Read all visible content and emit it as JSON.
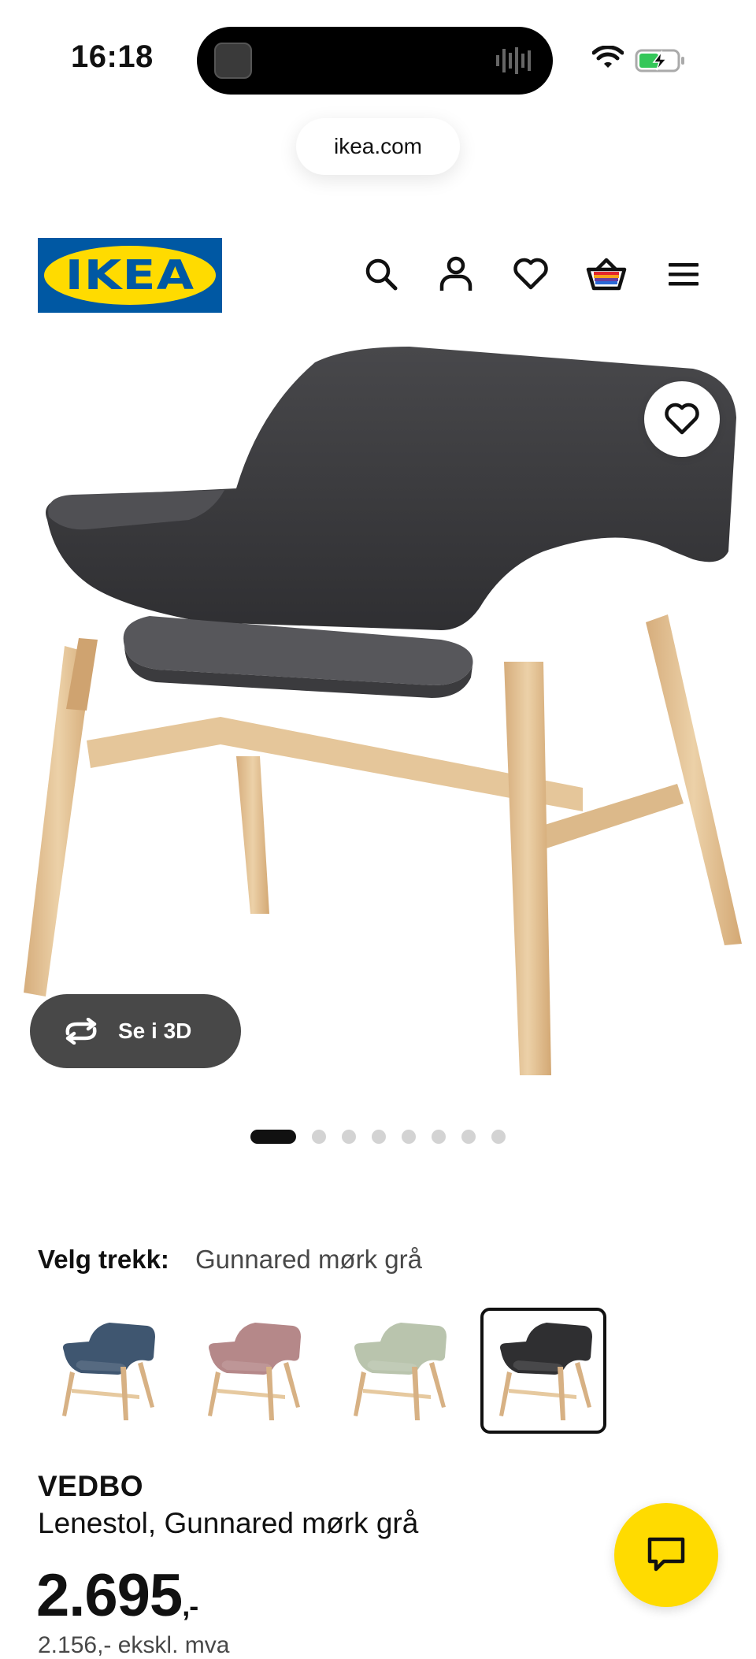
{
  "status_bar": {
    "time": "16:18",
    "island_icon": "audio-waveform-icon",
    "wifi_icon": "wifi-icon",
    "battery_icon": "battery-charging-icon"
  },
  "browser": {
    "url": "ikea.com"
  },
  "header": {
    "logo_text": "IKEA",
    "logo_reg": "®",
    "icons": [
      "search-icon",
      "account-icon",
      "heart-icon",
      "basket-icon",
      "menu-icon"
    ]
  },
  "gallery": {
    "view_3d_label": "Se i 3D",
    "total_images": 8,
    "active_index": 0
  },
  "variants": {
    "label": "Velg trekk:",
    "selected_value": "Gunnared mørk grå",
    "options": [
      {
        "color": "#3f5670",
        "selected": false
      },
      {
        "color": "#b58889",
        "selected": false
      },
      {
        "color": "#b9c4ad",
        "selected": false
      },
      {
        "color": "#2f2f31",
        "selected": true
      }
    ]
  },
  "product": {
    "name": "VEDBO",
    "description": "Lenestol, Gunnared mørk grå",
    "price": "2.695",
    "price_suffix": ",-",
    "vat_line": "2.156,- ekskl. mva"
  },
  "colors": {
    "ikea_blue": "#0058a3",
    "ikea_yellow": "#ffdb00",
    "chat_yellow": "#ffdb00"
  }
}
